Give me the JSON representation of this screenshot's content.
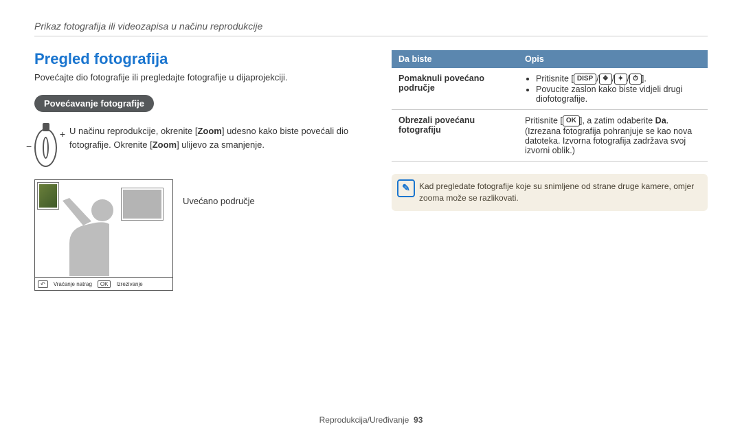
{
  "header": "Prikaz fotografija ili videozapisa u načinu reprodukcije",
  "title": "Pregled fotografija",
  "intro": "Povećajte dio fotografije ili pregledajte fotografije u dijaprojekciji.",
  "pill": "Povećavanje fotografije",
  "zoom_dial": {
    "minus": "−",
    "plus": "+"
  },
  "zoom_text_a": "U načinu reprodukcije, okrenite [",
  "zoom_text_b": "Zoom",
  "zoom_text_c": "] udesno kako biste povećali dio fotografije. Okrenite [",
  "zoom_text_d": "Zoom",
  "zoom_text_e": "] ulijevo za smanjenje.",
  "preview": {
    "footer_back_icon": "↶",
    "footer_back": "Vraćanje natrag",
    "footer_ok_icon": "OK",
    "footer_crop": "Izrezivanje",
    "label": "Uvećano područje"
  },
  "table": {
    "col1": "Da biste",
    "col2": "Opis",
    "row1_key": "Pomaknuli povećano područje",
    "row1_li1a": "Pritisnite [",
    "row1_li1_disp": "DISP",
    "row1_li1_sep1": "/",
    "row1_li1_icon1": "❖",
    "row1_li1_sep2": "/",
    "row1_li1_icon2": "✦",
    "row1_li1_sep3": "/",
    "row1_li1_icon3": "⏱",
    "row1_li1b": "].",
    "row1_li2": "Povucite zaslon kako biste vidjeli drugi diofotografije.",
    "row2_key": "Obrezali povećanu fotografiju",
    "row2_a": "Pritisnite [",
    "row2_ok": "OK",
    "row2_b": "], a zatim odaberite ",
    "row2_da": "Da",
    "row2_c": ". (Izrezana fotografija pohranjuje se kao nova datoteka. Izvorna fotografija zadržava svoj izvorni oblik.)"
  },
  "note_icon": "✎",
  "note_text": "Kad pregledate fotografije koje su snimljene od strane druge kamere, omjer zooma može se razlikovati.",
  "footer_section": "Reprodukcija/Uređivanje",
  "footer_page": "93"
}
